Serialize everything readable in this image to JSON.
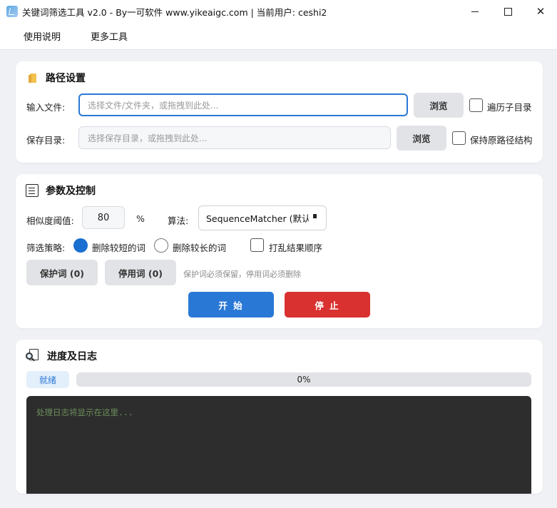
{
  "window": {
    "title": "关键词筛选工具 v2.0 - By一可软件 www.yikeaigc.com  |  当前用户: ceshi2",
    "minimize_icon": "minimize-icon",
    "maximize_icon": "maximize-icon",
    "close_glyph": "✕"
  },
  "menu": {
    "items": [
      "使用说明",
      "更多工具"
    ]
  },
  "path_settings": {
    "title": "路径设置",
    "icon": "folder-icon",
    "input_label": "输入文件:",
    "input_placeholder": "选择文件/文件夹，或拖拽到此处...",
    "input_browse": "浏览",
    "recursive_label": "遍历子目录",
    "recursive_checked": false,
    "save_label": "保存目录:",
    "save_placeholder": "选择保存目录，或拖拽到此处...",
    "save_browse": "浏览",
    "keep_structure_label": "保持原路径结构",
    "keep_structure_checked": false
  },
  "params": {
    "title": "参数及控制",
    "icon": "list-icon",
    "threshold_label": "相似度阈值:",
    "threshold_value": "80",
    "percent": "%",
    "algo_label": "算法:",
    "algo_value": "SequenceMatcher (默认",
    "strategy_label": "筛选策略:",
    "strategy_options": [
      "删除较短的词",
      "删除较长的词"
    ],
    "strategy_selected": 0,
    "shuffle_label": "打乱结果顺序",
    "shuffle_checked": false,
    "protect_button": "保护词 (0)",
    "stop_words_button": "停用词 (0)",
    "hint": "保护词必须保留，停用词必须删除",
    "start_button": "开 始",
    "stop_button": "停 止",
    "colors": {
      "start": "#2a78d6",
      "stop": "#d93030"
    }
  },
  "progress": {
    "title": "进度及日志",
    "icon": "log-magnifier-icon",
    "status": "就绪",
    "percent_value": 0,
    "percent_text": "0%",
    "log_placeholder": "处理日志将显示在这里..."
  }
}
